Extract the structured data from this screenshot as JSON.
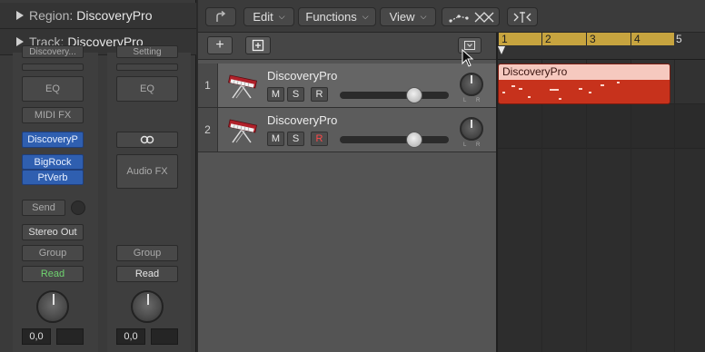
{
  "inspector": {
    "region_label": "Region:",
    "region_name": "DiscoveryPro",
    "track_label": "Track:",
    "track_name": "DiscoveryPro",
    "strip1": {
      "setting": "Discovery...",
      "eq": "EQ",
      "midi_fx": "MIDI FX",
      "instrument": "DiscoveryP",
      "audio_fx": [
        "BigRock",
        "PtVerb"
      ],
      "send": "Send",
      "output": "Stereo Out",
      "group": "Group",
      "automation": "Read",
      "volume": "0,0"
    },
    "strip2": {
      "setting": "Setting",
      "eq": "EQ",
      "audio_fx": "Audio FX",
      "group": "Group",
      "automation": "Read",
      "volume": "0,0"
    }
  },
  "toolbar": {
    "menus": [
      "Edit",
      "Functions",
      "View"
    ]
  },
  "tracks": [
    {
      "number": "1",
      "name": "DiscoveryPro",
      "mute": "M",
      "solo": "S",
      "record": "R",
      "record_armed": false,
      "volume_fraction": 0.72
    },
    {
      "number": "2",
      "name": "DiscoveryPro",
      "mute": "M",
      "solo": "S",
      "record": "R",
      "record_armed": true,
      "volume_fraction": 0.72
    }
  ],
  "pan_labels": {
    "left": "L",
    "right": "R"
  },
  "ruler": {
    "bars": [
      "1",
      "2",
      "3",
      "4",
      "5"
    ],
    "cycle_color": "#c7a43f"
  },
  "region": {
    "name": "DiscoveryPro",
    "header_color": "#f6c9bf",
    "body_color": "#c7321c"
  },
  "colors": {
    "instrument_blue": "#2f5fb0",
    "read_green": "#6fd36f",
    "record_red": "#ff4a4a"
  }
}
